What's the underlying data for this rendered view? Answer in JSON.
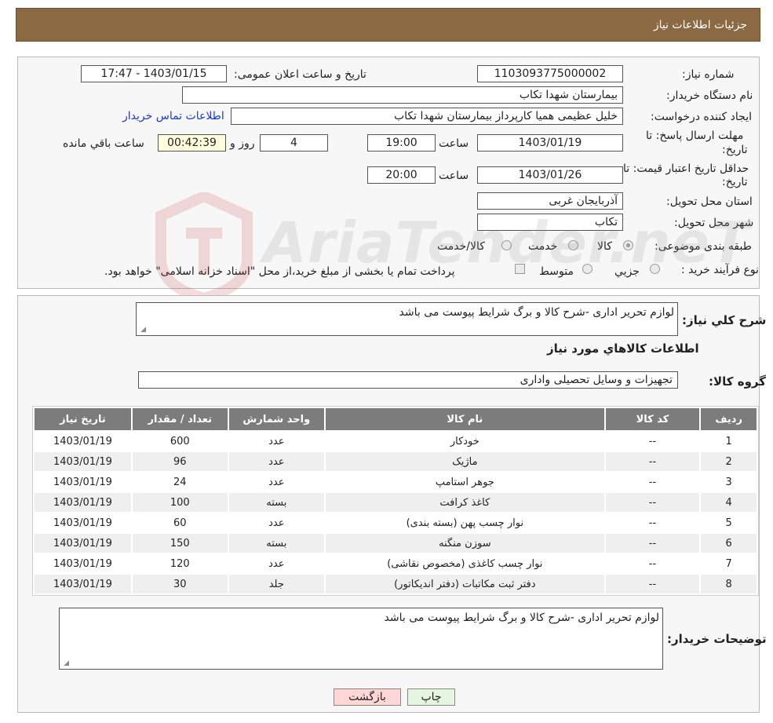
{
  "header": {
    "title": "جزئیات اطلاعات نیاز"
  },
  "form": {
    "need_number": {
      "label": "شماره نیاز:",
      "value": "1103093775000002"
    },
    "announce_datetime": {
      "label": "تاریخ و ساعت اعلان عمومی:",
      "value": "1403/01/15 - 17:47"
    },
    "buyer_org": {
      "label": "نام دستگاه خریدار:",
      "value": "بیمارستان شهدا تکاب"
    },
    "requester": {
      "label": "ایجاد کننده درخواست:",
      "value": "خلیل عظیمی همیا کارپرداز بیمارستان شهدا تکاب"
    },
    "contact_link": "اطلاعات تماس خریدار",
    "reply_deadline": {
      "label_line1": "مهلت ارسال پاسخ: تا",
      "label_line2": "تاریخ:",
      "date": "1403/01/19",
      "time_label": "ساعت",
      "time": "19:00",
      "days": "4",
      "days_label": "روز و",
      "remaining": "00:42:39",
      "remaining_label": "ساعت باقي مانده"
    },
    "price_validity": {
      "label_line1": "حداقل تاریخ اعتبار قیمت: تا",
      "label_line2": "تاریخ:",
      "date": "1403/01/26",
      "time_label": "ساعت",
      "time": "20:00"
    },
    "province": {
      "label": "استان محل تحویل:",
      "value": "آذربایجان غربی"
    },
    "city": {
      "label": "شهر محل تحویل:",
      "value": "تکاب"
    },
    "category": {
      "label": "طبقه بندی موضوعی:",
      "options": [
        "کالا",
        "خدمت",
        "کالا/خدمت"
      ],
      "selected": 0
    },
    "purchase_type": {
      "label": "نوع فرآیند خرید :",
      "options": [
        "جزیي",
        "متوسط"
      ],
      "note": "پرداخت تمام یا بخشی از مبلغ خرید،از محل \"اسناد خزانه اسلامی\" خواهد بود."
    }
  },
  "details": {
    "general_desc_label": "شرح کلي نياز:",
    "general_desc": "لوازم تحریر اداری -شرح کالا و برگ شرایط پیوست می باشد",
    "items_title": "اطلاعات كالاهاي مورد نياز",
    "group_label": "گروه کالا:",
    "group_value": "تجهیزات و وسایل تحصیلی واداری",
    "columns": [
      "رديف",
      "کد کالا",
      "نام کالا",
      "واحد شمارش",
      "تعداد / مقدار",
      "تاریخ نیاز"
    ],
    "rows": [
      [
        "1",
        "--",
        "خودکار",
        "عدد",
        "600",
        "1403/01/19"
      ],
      [
        "2",
        "--",
        "ماژیک",
        "عدد",
        "96",
        "1403/01/19"
      ],
      [
        "3",
        "--",
        "جوهر استامپ",
        "عدد",
        "24",
        "1403/01/19"
      ],
      [
        "4",
        "--",
        "کاغذ کرافت",
        "بسته",
        "100",
        "1403/01/19"
      ],
      [
        "5",
        "--",
        "نوار چسب پهن (بسته بندی)",
        "عدد",
        "60",
        "1403/01/19"
      ],
      [
        "6",
        "--",
        "سوزن منگنه",
        "بسته",
        "150",
        "1403/01/19"
      ],
      [
        "7",
        "--",
        "نوار چسب کاغذی (مخصوص نقاشی)",
        "عدد",
        "120",
        "1403/01/19"
      ],
      [
        "8",
        "--",
        "دفتر ثبت مکاتبات (دفتر اندیکاتور)",
        "جلد",
        "30",
        "1403/01/19"
      ]
    ],
    "buyer_notes_label": "توضیحات خریدار:",
    "buyer_notes": "لوازم تحریر اداری -شرح کالا و برگ شرایط پیوست می باشد"
  },
  "buttons": {
    "print": "چاپ",
    "back": "بازگشت"
  },
  "watermark": {
    "text": "AriaTender.neT"
  },
  "colors": {
    "header_bg": "#8b6a43",
    "table_header_bg": "#7c7c7c",
    "link": "#1a3cc8",
    "back_button": "#ffd7d7",
    "print_button": "#e6f5e0"
  }
}
